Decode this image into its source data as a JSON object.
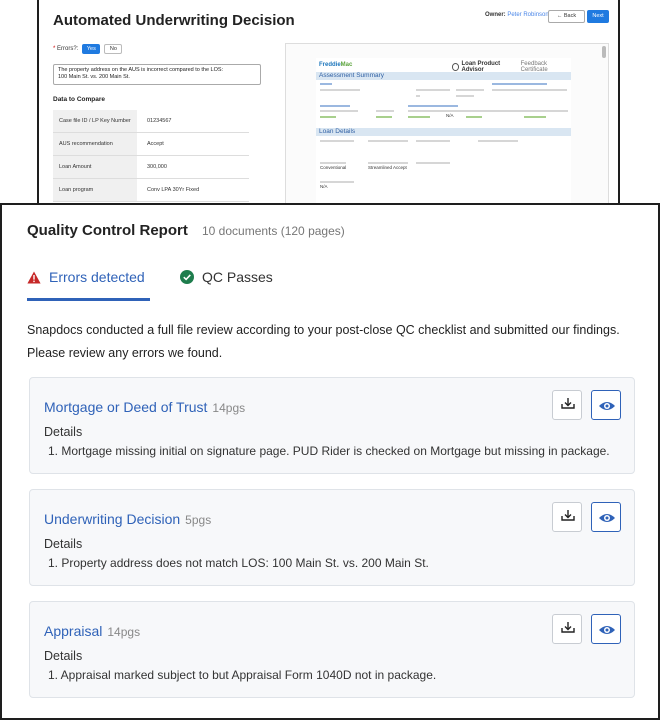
{
  "underwriting": {
    "title": "Automated Underwriting Decision",
    "owner_label": "Owner:",
    "owner_name": "Peter Robinson",
    "back_label": "← Back",
    "next_label": "Next",
    "errors_label": "Errors?:",
    "yes_label": "Yes",
    "no_label": "No",
    "note_line1": "The property address on the AUS is incorrect compared to the LOS:",
    "note_line2": "100 Main St. vs. 200 Main St.",
    "data_heading": "Data to Compare",
    "rows": [
      {
        "key": "Case file ID / LP Key Number",
        "value": "01234567"
      },
      {
        "key": "AUS recommendation",
        "value": "Accept"
      },
      {
        "key": "Loan Amount",
        "value": "300,000"
      },
      {
        "key": "Loan program",
        "value": "Conv LPA 30Yr Fixed"
      }
    ],
    "certificate": {
      "logo_main": "Freddie",
      "logo_mac": "Mac",
      "product": "Loan Product Advisor",
      "product_sub": "Feedback Certificate",
      "section1": "Assessment Summary",
      "section2": "Loan Details",
      "mortgage_type": "Conventional",
      "doc_level": "Streamlined Accept",
      "na": "N/A"
    }
  },
  "qc": {
    "title": "Quality Control Report",
    "subtitle": "10 documents (120 pages)",
    "tab_errors": "Errors detected",
    "tab_passes": "QC Passes",
    "intro": "Snapdocs conducted a full file review according to your post-close QC checklist and submitted our findings. Please review any errors we found.",
    "details_label": "Details",
    "documents": [
      {
        "name": "Mortgage or Deed of Trust",
        "pages": "14pgs",
        "detail": "1. Mortgage missing initial on signature page. PUD Rider is checked on Mortgage but missing in package."
      },
      {
        "name": "Underwriting Decision",
        "pages": "5pgs",
        "detail": "1. Property address does not match LOS: 100 Main St. vs. 200 Main St."
      },
      {
        "name": "Appraisal",
        "pages": "14pgs",
        "detail": "1. Appraisal marked subject to but Appraisal Form 1040D not in package."
      }
    ]
  },
  "colors": {
    "accent": "#2f62b8",
    "primary_button": "#1f7ae0",
    "error": "#c62828",
    "success": "#1e7d4d"
  }
}
